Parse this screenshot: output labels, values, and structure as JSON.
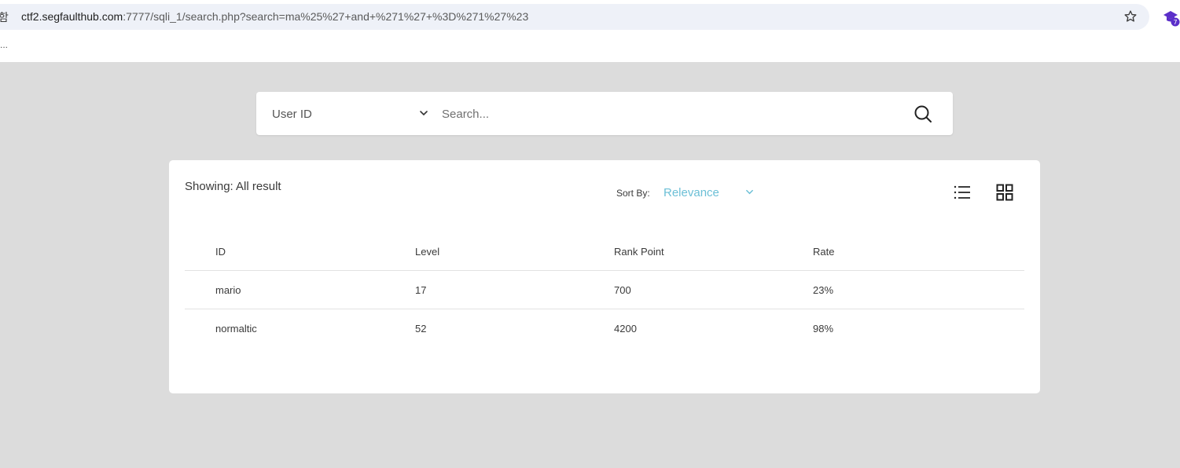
{
  "browser": {
    "site_badge": "함",
    "url_host": "ctf2.segfaulthub.com",
    "url_rest": ":7777/sqli_1/search.php?search=ma%25%27+and+%271%27+%3D%271%27%23",
    "bookmarks_text": "...",
    "extension_badge_count": "7",
    "icons": {
      "bookmark": "star-icon",
      "extension": "extension-icon"
    }
  },
  "search": {
    "field_select": "User ID",
    "placeholder": "Search...",
    "value": "",
    "icons": {
      "dropdown": "chevron-down-icon",
      "submit": "search-icon"
    }
  },
  "results": {
    "showing": "Showing: All result",
    "sort_label": "Sort By:",
    "sort_value": "Relevance",
    "accent_color": "#6bbfd6",
    "view_icons": [
      "list-view-icon",
      "grid-view-icon"
    ],
    "columns": [
      "ID",
      "Level",
      "Rank Point",
      "Rate"
    ],
    "rows": [
      [
        "mario",
        "17",
        "700",
        "23%"
      ],
      [
        "normaltic",
        "52",
        "4200",
        "98%"
      ]
    ]
  }
}
